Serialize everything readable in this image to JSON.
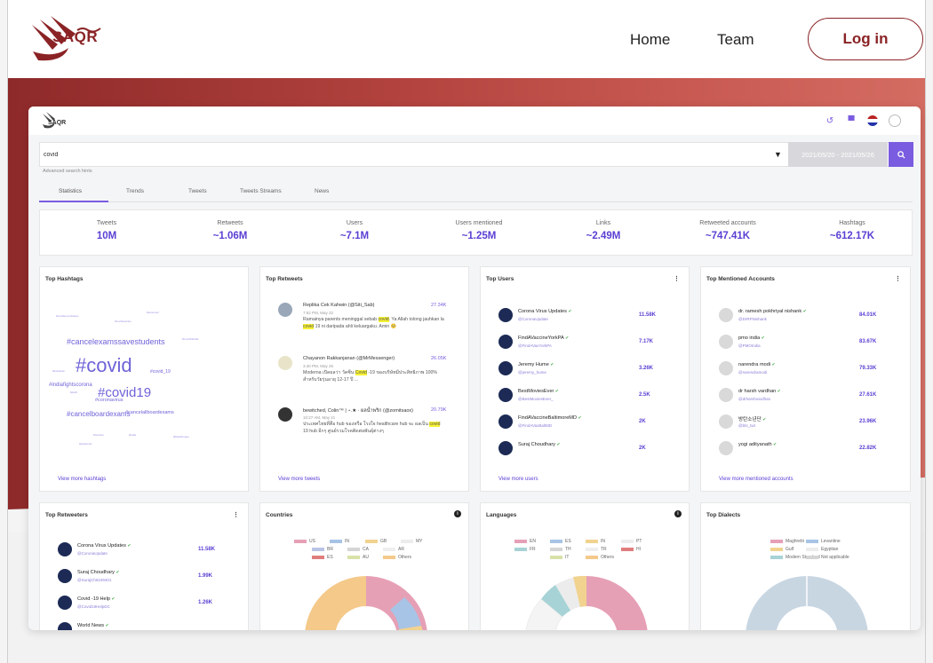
{
  "site": {
    "logo_text": "SAQR",
    "nav": {
      "home": "Home",
      "team": "Team",
      "login": "Log in"
    }
  },
  "app": {
    "logo_text": "SAQR",
    "search": {
      "value": "covid",
      "date_range": "2021/05/20 - 2021/05/26",
      "advanced": "Advanced search hints"
    },
    "tabs": [
      "Statistics",
      "Trends",
      "Tweets",
      "Tweets Streams",
      "News"
    ],
    "stats": [
      {
        "label": "Tweets",
        "value": "10M"
      },
      {
        "label": "Retweets",
        "value": "~1.06M"
      },
      {
        "label": "Users",
        "value": "~7.1M"
      },
      {
        "label": "Users mentioned",
        "value": "~1.25M"
      },
      {
        "label": "Links",
        "value": "~2.49M"
      },
      {
        "label": "Retweeted accounts",
        "value": "~747.41K"
      },
      {
        "label": "Hashtags",
        "value": "~612.17K"
      }
    ]
  },
  "cards": {
    "hashtags": {
      "title": "Top Hashtags",
      "footer": "View more hashtags",
      "words": [
        {
          "t": "#covid",
          "s": 22
        },
        {
          "t": "#covid19",
          "s": 15
        },
        {
          "t": "#cancelexamssavestudents",
          "s": 9
        },
        {
          "t": "#cancelboardexams",
          "s": 8
        },
        {
          "t": "#indiafightscorona",
          "s": 6
        },
        {
          "t": "#coronavirus",
          "s": 5.5
        },
        {
          "t": "#cancelallboardexams",
          "s": 5.5
        },
        {
          "t": "#covid_19",
          "s": 5
        },
        {
          "t": "#covidvaccine",
          "s": 3
        },
        {
          "t": "#covidsecondwave",
          "s": 3
        },
        {
          "t": "#lockdown",
          "s": 3
        },
        {
          "t": "#pandemic",
          "s": 3
        },
        {
          "t": "#vaccine",
          "s": 3
        },
        {
          "t": "#india",
          "s": 3
        },
        {
          "t": "#blackfungus",
          "s": 3
        },
        {
          "t": "#sarscov2",
          "s": 3
        },
        {
          "t": "#delhi",
          "s": 3
        },
        {
          "t": "#covid19india",
          "s": 3
        }
      ]
    },
    "retweets": {
      "title": "Top Retweets",
      "footer": "View more tweets",
      "items": [
        {
          "name": "Replika Cek Kahwin (@Siti_Sab)",
          "count": "27.34K",
          "time": "7:52 PM, May 22",
          "before": "Ramainya parents meninggal sebab ",
          "hl1": "covid",
          "mid": ". Ya Allah tolong jauhkan la ",
          "hl2": "covid",
          "after": " 19 ni daripada ahli keluargaku. Amin 🥺"
        },
        {
          "name": "Chayanon Rakkanjanan (@MrMessenger)",
          "count": "26.05K",
          "time": "3:40 PM, May 25",
          "before": "Moderna เปิดผลว่า วัคซีน ",
          "hl1": "Covid",
          "mid": " -19 ของบริษัทมีประสิทธิภาพ 100% สำหรับวัยรุ่นอายุ 12-17 ปี ... ",
          "hl2": "",
          "after": ""
        },
        {
          "name": "bewitched, Colin™ | ⋆.★ · ผลน้ำพริก (@zomitsaox)",
          "count": "20.79K",
          "time": "10:27 AM, May 21",
          "before": "ประเทศไทยที่คือ hub ของหรือ โรงใจ healthcare hub จะ ผลเป็น ",
          "hl1": "covid",
          "mid": " 19 hub อีกๆ ศูนย์รวมโรคติดต่อพันธุ์ต่างๆ",
          "hl2": "",
          "after": ""
        }
      ]
    },
    "users": {
      "title": "Top Users",
      "menu": "⋮",
      "footer": "View more users",
      "items": [
        {
          "name": "Corona Virus Updates",
          "handle": "@CoronaUpdate",
          "count": "11.58K"
        },
        {
          "name": "FindAVaccineYorkPA",
          "handle": "@FindAVaxYorkPA",
          "count": "7.17K"
        },
        {
          "name": "Jeremy Hume",
          "handle": "@jeremy_hume",
          "count": "3.26K"
        },
        {
          "name": "BestMoviesEver",
          "handle": "@BestMoviesEver_",
          "count": "2.5K"
        },
        {
          "name": "FindAVaccineBaltimoreMD",
          "handle": "@FindAVaxBaltMD",
          "count": "2K"
        },
        {
          "name": "Suraj Choudhary",
          "handle": "",
          "count": "2K"
        }
      ]
    },
    "mentioned": {
      "title": "Top Mentioned Accounts",
      "menu": "⋮",
      "footer": "View more mentioned accounts",
      "items": [
        {
          "name": "dr. ramesh pokhriyal nishank",
          "handle": "@DrRPNishank",
          "count": "84.01K"
        },
        {
          "name": "pmo india",
          "handle": "@PMOIndia",
          "count": "83.67K"
        },
        {
          "name": "narendra modi",
          "handle": "@narendramodi",
          "count": "79.33K"
        },
        {
          "name": "dr harsh vardhan",
          "handle": "@drharshvardhan",
          "count": "27.61K"
        },
        {
          "name": "방탄소년단",
          "handle": "@bts_twt",
          "count": "23.96K"
        },
        {
          "name": "yogi adityanath",
          "handle": "",
          "count": "22.82K"
        }
      ]
    },
    "retweeters": {
      "title": "Top Retweeters",
      "menu": "⋮",
      "items": [
        {
          "name": "Corona Virus Updates",
          "handle": "@CoronaUpdate",
          "count": "11.58K"
        },
        {
          "name": "Suraj Choudhary",
          "handle": "@SurajCh6249401",
          "count": "1.99K"
        },
        {
          "name": "Covid -19 Help",
          "handle": "@Covid19HelpDC",
          "count": "1.26K"
        },
        {
          "name": "World News",
          "handle": "",
          "count": ""
        }
      ]
    },
    "countries": {
      "title": "Countries",
      "legend": [
        {
          "l": "US",
          "c": "#e6a0b5"
        },
        {
          "l": "IN",
          "c": "#a7c4e6"
        },
        {
          "l": "GB",
          "c": "#f1d38f"
        },
        {
          "l": "MY",
          "c": "#ececec"
        },
        {
          "l": "BR",
          "c": "#b9c3e6"
        },
        {
          "l": "CA",
          "c": "#d5d5d5"
        },
        {
          "l": "AR",
          "c": "#eeeeee"
        },
        {
          "l": "ES",
          "c": "#e07d7d"
        },
        {
          "l": "AU",
          "c": "#d8e2a8"
        },
        {
          "l": "Others",
          "c": "#f4c98a"
        }
      ]
    },
    "languages": {
      "title": "Languages",
      "legend": [
        {
          "l": "EN",
          "c": "#e6a0b5"
        },
        {
          "l": "ES",
          "c": "#a7c4e6"
        },
        {
          "l": "IN",
          "c": "#f1d38f"
        },
        {
          "l": "PT",
          "c": "#ececec"
        },
        {
          "l": "FR",
          "c": "#a7d3d6"
        },
        {
          "l": "TH",
          "c": "#d5d5d5"
        },
        {
          "l": "TR",
          "c": "#eeeeee"
        },
        {
          "l": "HI",
          "c": "#e07d7d"
        },
        {
          "l": "IT",
          "c": "#d8e2a8"
        },
        {
          "l": "Others",
          "c": "#f4c98a"
        }
      ]
    },
    "dialects": {
      "title": "Top Dialects",
      "legend": [
        {
          "l": "Maghrebi",
          "c": "#e6a0b5"
        },
        {
          "l": "Levantine",
          "c": "#a7c4e6"
        },
        {
          "l": "Gulf",
          "c": "#f1d38f"
        },
        {
          "l": "Egyptian",
          "c": "#ececec"
        },
        {
          "l": "Modern Standard",
          "c": "#a7d3d6"
        },
        {
          "l": "Not applicable",
          "c": "#d5d5d5"
        }
      ]
    }
  }
}
